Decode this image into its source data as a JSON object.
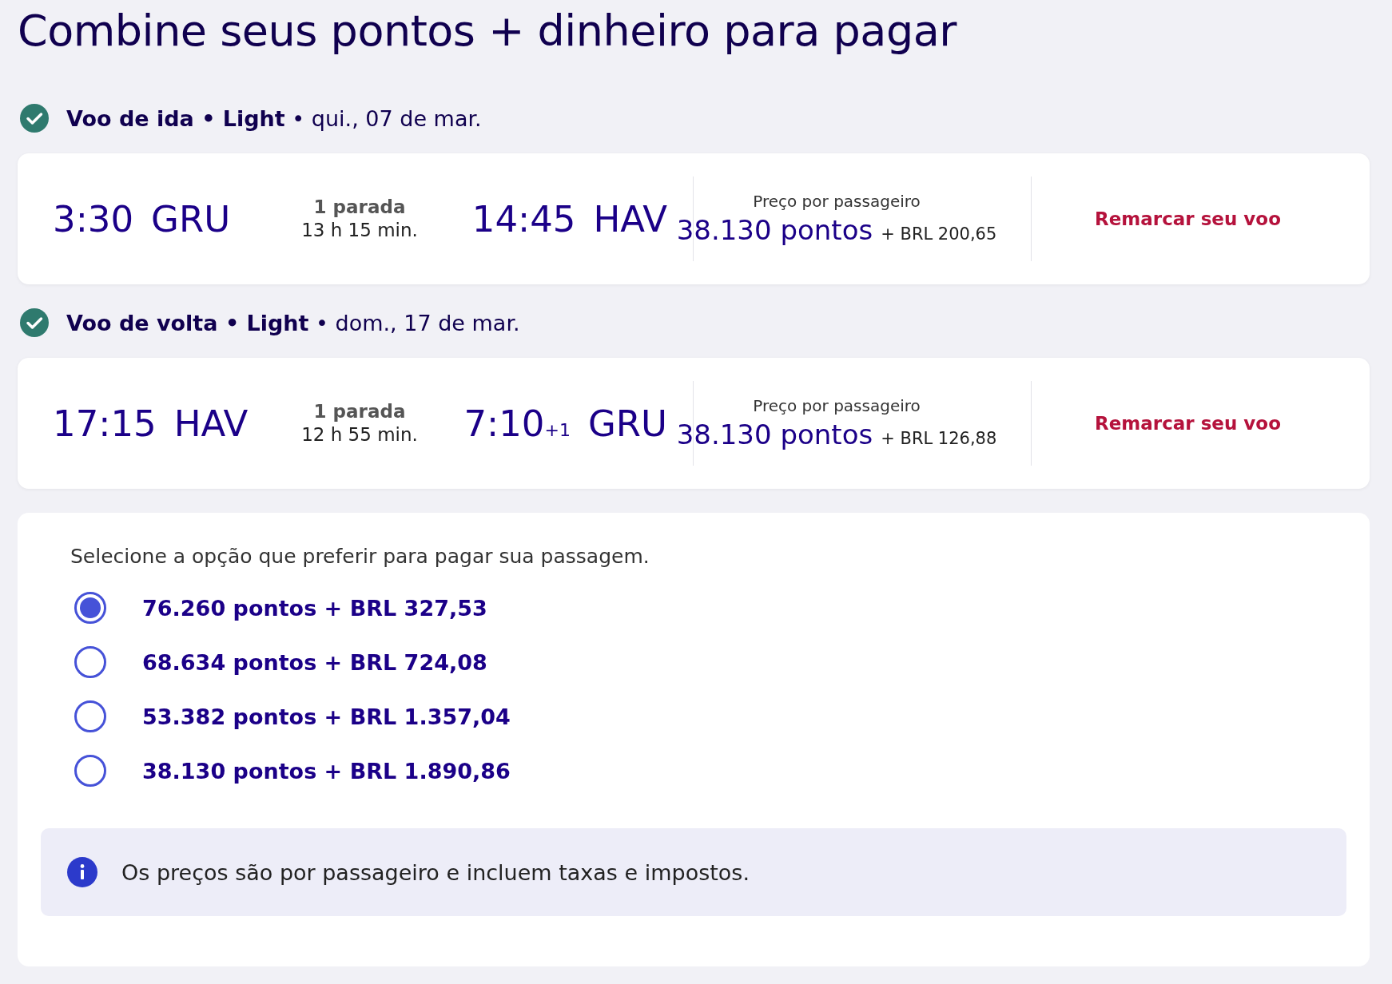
{
  "page_title": "Combine seus pontos + dinheiro para pagar",
  "flights": [
    {
      "header": "**Voo de ida • Light** • qui., 07 de mar.",
      "confirmed": true,
      "departure": {
        "time": "3:30",
        "airport": "GRU"
      },
      "stops": "1 parada",
      "duration": "13 h 15 min.",
      "arrival": {
        "time": "14:45",
        "airport": "HAV"
      },
      "price_label": "Preço por passageiro",
      "points": "38.130 pontos",
      "cash": "+ BRL 200,65",
      "action": "Remarcar seu voo"
    },
    {
      "header": "**Voo de volta • Light** • dom., 17 de mar.",
      "confirmed": true,
      "departure": {
        "time": "17:15",
        "airport": "HAV"
      },
      "stops": "1 parada",
      "duration": "12 h 55 min.",
      "arrival": {
        "time": "7:10",
        "day_offset": "+1",
        "airport": "GRU"
      },
      "price_label": "Preço por passageiro",
      "points": "38.130 pontos",
      "cash": "+ BRL 126,88",
      "action": "Remarcar seu voo"
    }
  ],
  "payment": {
    "prompt": "Selecione a opção que preferir para pagar sua passagem.",
    "options": [
      {
        "label": "76.260 pontos + BRL 327,53",
        "selected": true
      },
      {
        "label": "68.634 pontos + BRL 724,08",
        "selected": false
      },
      {
        "label": "53.382 pontos + BRL 1.357,04",
        "selected": false
      },
      {
        "label": "38.130 pontos + BRL 1.890,86",
        "selected": false
      }
    ],
    "info": "Os preços são por passageiro e incluem taxas e impostos."
  }
}
